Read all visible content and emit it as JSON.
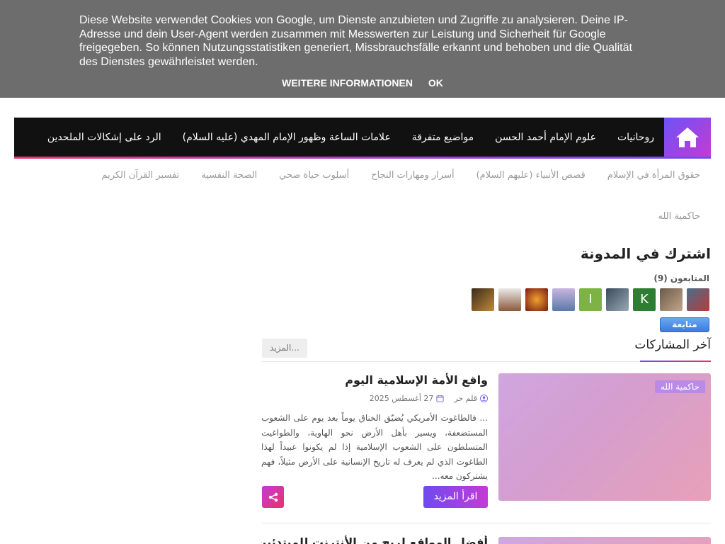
{
  "cookie": {
    "text": "Diese Website verwendet Cookies von Google, um Dienste anzubieten und Zugriffe zu analysieren. Deine IP-Adresse und dein User-Agent werden zusammen mit Messwerten zur Leistung und Sicherheit für Google freigegeben. So können Nutzungsstatistiken generiert, Missbrauchsfälle erkannt und behoben und die Qualität des Dienstes gewährleistet werden.",
    "more_label": "WEITERE INFORMATIONEN",
    "ok_label": "OK"
  },
  "nav": {
    "home_icon": "home-icon",
    "items": [
      "روحانيات",
      "علوم الإمام أحمد الحسن",
      "مواضيع متفرقة",
      "علامات الساعة وظهور الإمام المهدي (عليه السلام)",
      "الرد على إشكالات الملحدين"
    ]
  },
  "subnav": {
    "items": [
      "حقوق المرأة في الإسلام",
      "قصص الأنبياء (عليهم السلام)",
      "أسرار ومهارات النجاح",
      "أسلوب حياة صحي",
      "الصحة النفسية",
      "تفسير القرآن الكريم"
    ],
    "second_row": "حاكمية الله"
  },
  "subscribe": {
    "title": "اشترك في المدونة",
    "followers_label": "المتابعون (9)",
    "follow_label": "متابعة"
  },
  "latest": {
    "title": "آخر المشاركات",
    "more_label": "المزيد..."
  },
  "post1": {
    "tag": "حاكمية الله",
    "title": "واقع الأمة الإسلامية اليوم",
    "author": "قلم حر",
    "date": "27 أغسطس 2025",
    "excerpt": "... فالطاغوت الأمريكي يُضيّق الخناق يوماً بعد يوم على الشعوب المستضعفة، ويسير بأهل الأرض نحو الهاوية، والطواغيت المتسلطون على الشعوب الإسلامية إذا لم يكونوا عبيداً لهذا الطاغوت الذي لم يعرف له تاريخ الإنسانية على الأرض مثيلاً، فهم يشتركون معه...",
    "read_more": "اقرأ المزيد"
  },
  "post2": {
    "title": "أفضل المواقع لربح من الأنترنت للمبتدئين"
  },
  "colors": {
    "accent_start": "#6e4af0",
    "accent_end": "#e8336b",
    "nav_bg": "#111111",
    "cookie_bg": "#6d6d6d"
  }
}
